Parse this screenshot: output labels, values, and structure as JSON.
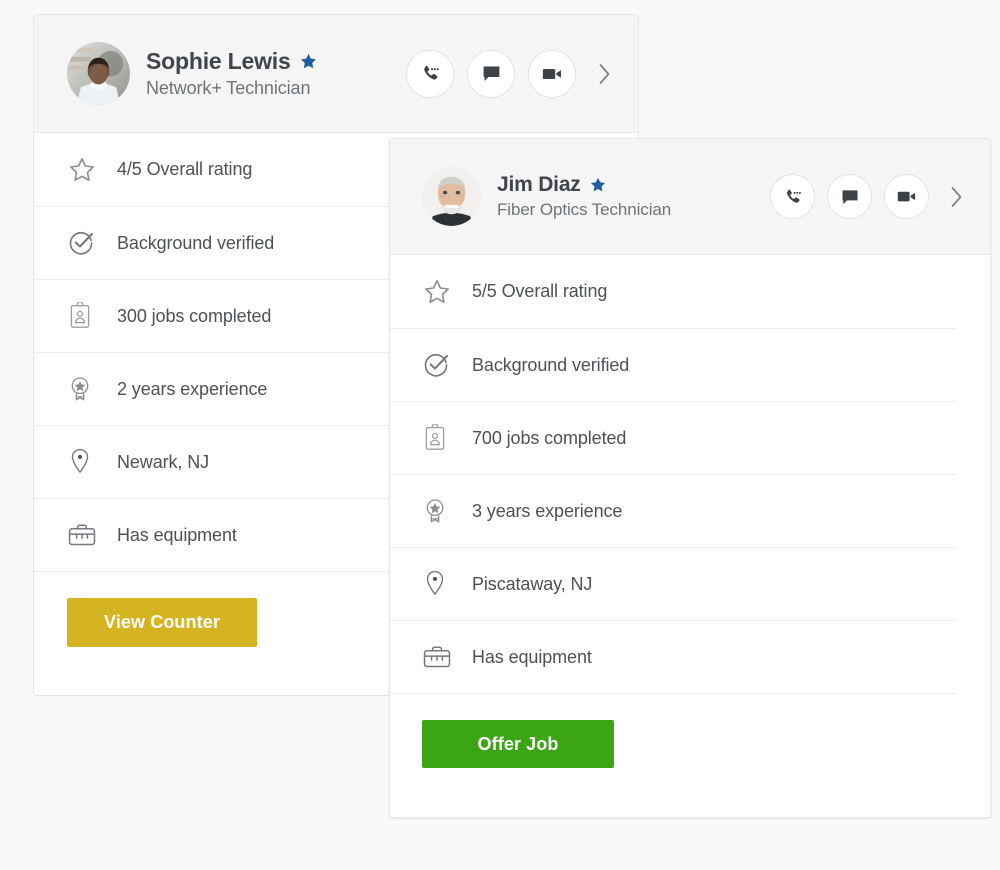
{
  "theme": {
    "page_background": "#f9f9f9",
    "card_background": "#ffffff",
    "header_background": "#f5f5f5",
    "divider": "#ededed",
    "text_primary": "#40464b",
    "text_secondary": "#6d7478",
    "verified_star_color": "#1e5e9e",
    "icon_color": "#8b8f93",
    "view_counter_color": "#d4b420",
    "offer_job_color": "#3ba514"
  },
  "cards": [
    {
      "id": "sophie-lewis",
      "name": "Sophie Lewis",
      "role": "Network+ Technician",
      "verified_badge_icon": "verified-star-icon",
      "avatar_icon": "avatar-photo-sophie-lewis",
      "actions": [
        {
          "icon": "phone-icon",
          "label": "Call"
        },
        {
          "icon": "chat-bubble-icon",
          "label": "Message"
        },
        {
          "icon": "video-camera-icon",
          "label": "Video call"
        }
      ],
      "next_icon": "chevron-right-icon",
      "details": [
        {
          "icon": "star-outline-icon",
          "label": "4/5 Overall rating"
        },
        {
          "icon": "check-circle-icon",
          "label": "Background verified"
        },
        {
          "icon": "clipboard-person-icon",
          "label": "300 jobs completed"
        },
        {
          "icon": "award-badge-icon",
          "label": "2 years experience"
        },
        {
          "icon": "location-pin-icon",
          "label": "Newark, NJ"
        },
        {
          "icon": "briefcase-icon",
          "label": "Has equipment"
        }
      ],
      "cta": {
        "label": "View Counter",
        "color": "#d4b420"
      }
    },
    {
      "id": "jim-diaz",
      "name": "Jim Diaz",
      "role": "Fiber Optics Technician",
      "verified_badge_icon": "verified-star-icon",
      "avatar_icon": "avatar-photo-jim-diaz",
      "actions": [
        {
          "icon": "phone-icon",
          "label": "Call"
        },
        {
          "icon": "chat-bubble-icon",
          "label": "Message"
        },
        {
          "icon": "video-camera-icon",
          "label": "Video call"
        }
      ],
      "next_icon": "chevron-right-icon",
      "details": [
        {
          "icon": "star-outline-icon",
          "label": "5/5 Overall rating"
        },
        {
          "icon": "check-circle-icon",
          "label": "Background verified"
        },
        {
          "icon": "clipboard-person-icon",
          "label": "700 jobs completed"
        },
        {
          "icon": "award-badge-icon",
          "label": "3 years experience"
        },
        {
          "icon": "location-pin-icon",
          "label": "Piscataway, NJ"
        },
        {
          "icon": "briefcase-icon",
          "label": "Has equipment"
        }
      ],
      "cta": {
        "label": "Offer Job",
        "color": "#3ba514"
      }
    }
  ]
}
